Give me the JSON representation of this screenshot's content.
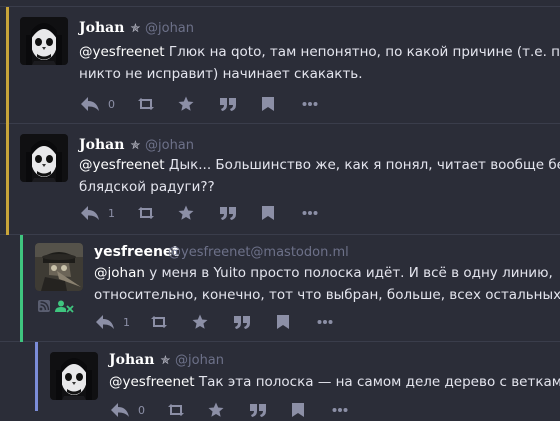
{
  "posts": [
    {
      "name": "Johan",
      "handle": "@johan",
      "mention": "@yesfreenet",
      "line1": " Глюк на qoto, там непонятно, по какой причине (т.е. пон",
      "line2": "никто не исправит) начинает скакакть.",
      "replies": "0",
      "bar_color": "#c8a43a",
      "avatar": "face-icon"
    },
    {
      "name": "Johan",
      "handle": "@johan",
      "mention": "@yesfreenet",
      "line1": " Дык... Большинство же, как я понял, читает вообще без",
      "line2": "блядской радуги??",
      "replies": "1",
      "bar_color": "#c8a43a",
      "avatar": "face-icon"
    },
    {
      "name": "yesfreenet",
      "handle": "@yesfreenet@mastodon.ml",
      "mention": "@johan",
      "line1": " у меня в Yuito просто полоска идёт. И всё в одну линию,",
      "line2": "относительно, конечно, тот что выбран, больше, всех остальных",
      "replies": "1",
      "bar_color": "#3fc57f",
      "avatar": "plague-doctor-icon"
    },
    {
      "name": "Johan",
      "handle": "@johan",
      "mention": "@yesfreenet",
      "line1": " Так эта полоска — на самом деле дерево с веткамі",
      "line2": "",
      "replies": "0",
      "bar_color": "#7b8cd8",
      "avatar": "face-icon"
    }
  ],
  "colors": {
    "background": "#2b2d38",
    "icon": "#8c8fa6",
    "text": "#e4e5ee",
    "handle": "#6d7189",
    "badge_green": "#3fc57f"
  }
}
